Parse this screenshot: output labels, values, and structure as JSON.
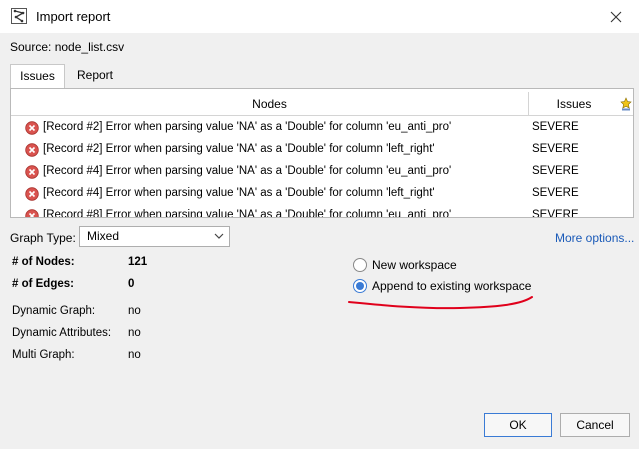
{
  "window": {
    "title": "Import report",
    "icon": "gephi-app-icon"
  },
  "source": {
    "label": "Source:",
    "value": "node_list.csv"
  },
  "tabs": [
    {
      "label": "Issues"
    },
    {
      "label": "Report"
    }
  ],
  "table": {
    "columns": [
      "Nodes",
      "Issues"
    ],
    "rows": [
      {
        "message": "[Record #2] Error when parsing value 'NA' as a 'Double' for column 'eu_anti_pro'",
        "severity": "SEVERE"
      },
      {
        "message": "[Record #2] Error when parsing value 'NA' as a 'Double' for column 'left_right'",
        "severity": "SEVERE"
      },
      {
        "message": "[Record #4] Error when parsing value 'NA' as a 'Double' for column 'eu_anti_pro'",
        "severity": "SEVERE"
      },
      {
        "message": "[Record #4] Error when parsing value 'NA' as a 'Double' for column 'left_right'",
        "severity": "SEVERE"
      },
      {
        "message": "[Record #8] Error when parsing value 'NA' as a 'Double' for column 'eu_anti_pro'",
        "severity": "SEVERE"
      }
    ]
  },
  "graph_type": {
    "label": "Graph Type:",
    "value": "Mixed"
  },
  "more_options": "More options...",
  "stats": {
    "nodes": {
      "label": "# of Nodes:",
      "value": "121"
    },
    "edges": {
      "label": "# of Edges:",
      "value": "0"
    },
    "dynamic_graph": {
      "label": "Dynamic Graph:",
      "value": "no"
    },
    "dynamic_attributes": {
      "label": "Dynamic Attributes:",
      "value": "no"
    },
    "multi_graph": {
      "label": "Multi Graph:",
      "value": "no"
    }
  },
  "workspace": {
    "options": [
      {
        "label": "New workspace",
        "checked": false
      },
      {
        "label": "Append to existing workspace",
        "checked": true
      }
    ]
  },
  "buttons": {
    "ok": "OK",
    "cancel": "Cancel"
  },
  "colors": {
    "accent": "#3a7bd5",
    "error": "#d9534f",
    "annotation": "#e0001b",
    "link": "#1a5ab8"
  }
}
